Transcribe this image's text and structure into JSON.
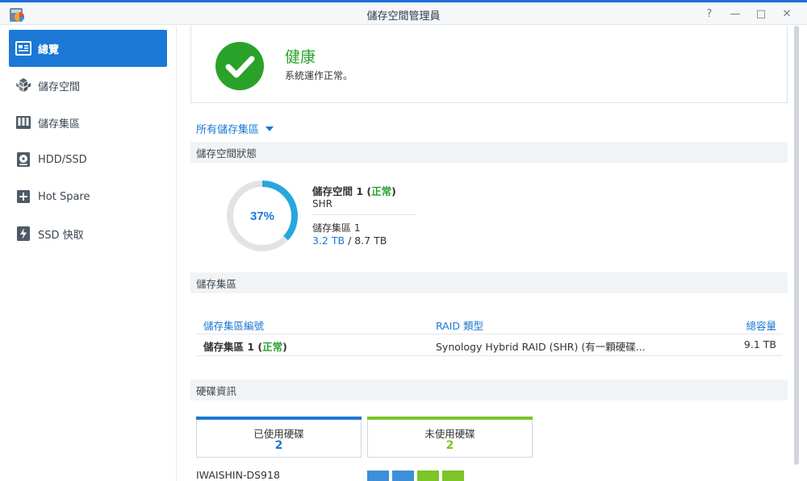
{
  "window": {
    "title": "儲存空間管理員",
    "buttons": [
      "?",
      "—",
      "□",
      "✕"
    ],
    "accent_color": "#1a6fd6"
  },
  "sidebar": {
    "items": [
      {
        "label": "總覽",
        "icon": "overview-icon",
        "active": true
      },
      {
        "label": "儲存空間",
        "icon": "volume-cubes-icon",
        "active": false
      },
      {
        "label": "儲存集區",
        "icon": "storage-pool-icon",
        "active": false
      },
      {
        "label": "HDD/SSD",
        "icon": "hdd-icon",
        "active": false
      },
      {
        "label": "Hot Spare",
        "icon": "hot-spare-icon",
        "active": false
      },
      {
        "label": "SSD 快取",
        "icon": "ssd-cache-icon",
        "active": false
      }
    ],
    "active_color": "#1b78d4"
  },
  "health": {
    "title": "健康",
    "description": "系統運作正常。",
    "icon": "check-circle-icon",
    "color": "#2aa22a"
  },
  "pool_selector": {
    "label": "所有儲存集區"
  },
  "volume_section": {
    "header": "儲存空間狀態",
    "usage_percent": 37,
    "usage_label": "37%",
    "volume_name": "儲存空間 1",
    "volume_status": "正常",
    "volume_type": "SHR",
    "pool_name": "儲存集區 1",
    "used": "3.2 TB",
    "separator": "/",
    "total": "8.7 TB"
  },
  "pool_section": {
    "header": "儲存集區",
    "columns": [
      "儲存集區編號",
      "RAID 類型",
      "總容量"
    ],
    "rows": [
      {
        "name": "儲存集區 1",
        "status": "正常",
        "raid": "Synology Hybrid RAID (SHR) (有一顆硬碟...",
        "capacity": "9.1 TB"
      }
    ]
  },
  "disk_section": {
    "header": "硬碟資訊",
    "used_label": "已使用硬碟",
    "used_count": "2",
    "used_color": "#1b78d4",
    "unused_label": "未使用硬碟",
    "unused_count": "2",
    "unused_color": "#7cc427",
    "host": "IWAISHIN-DS918",
    "slots": [
      "used",
      "used",
      "unused",
      "unused"
    ]
  }
}
